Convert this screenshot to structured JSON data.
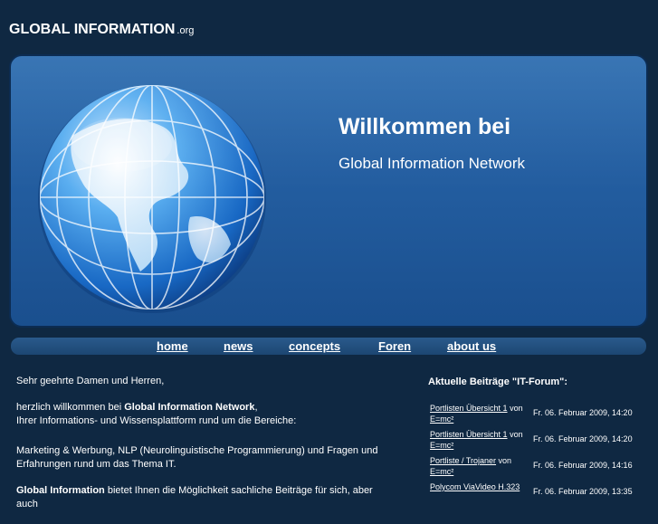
{
  "brand": {
    "name": "GLOBAL INFORMATION",
    "tld": ".org"
  },
  "hero": {
    "title": "Willkommen bei",
    "subtitle": "Global Information Network"
  },
  "nav": [
    {
      "label": "home"
    },
    {
      "label": "news"
    },
    {
      "label": "concepts"
    },
    {
      "label": "Foren"
    },
    {
      "label": "about us"
    }
  ],
  "content": {
    "greeting": "Sehr geehrte Damen und Herren,",
    "welcome_prefix": "herzlich willkommen bei ",
    "welcome_bold": "Global Information Network",
    "welcome_suffix": ",",
    "platform_line": "Ihrer Informations- und Wissensplattform rund um die Bereiche:",
    "topics": "Marketing & Werbung, NLP (Neurolinguistische Programmierung) und Fragen und Erfahrungen rund um das Thema IT.",
    "last_bold": "Global Information",
    "last_rest": " bietet Ihnen die Möglichkeit sachliche Beiträge für sich, aber auch"
  },
  "forum": {
    "title": "Aktuelle Beiträge \"IT-Forum\":",
    "von": "von",
    "posts": [
      {
        "topic": "Portlisten Übersicht 1",
        "author": "E=mc²",
        "date": "Fr. 06. Februar 2009, 14:20"
      },
      {
        "topic": "Portlisten Übersicht 1",
        "author": "E=mc²",
        "date": "Fr. 06. Februar 2009, 14:20"
      },
      {
        "topic": "Portliste / Trojaner",
        "author": "E=mc²",
        "date": "Fr. 06. Februar 2009, 14:16"
      },
      {
        "topic": "Polycom ViaVideo H.323",
        "author": "",
        "date": "Fr. 06. Februar 2009, 13:35"
      }
    ]
  },
  "colors": {
    "page_bg": "#0f2842",
    "hero_bg": "#245fa2",
    "nav_bg": "#1c4672",
    "text": "#ffffff"
  },
  "icons": {
    "globe": "globe-illustration"
  }
}
